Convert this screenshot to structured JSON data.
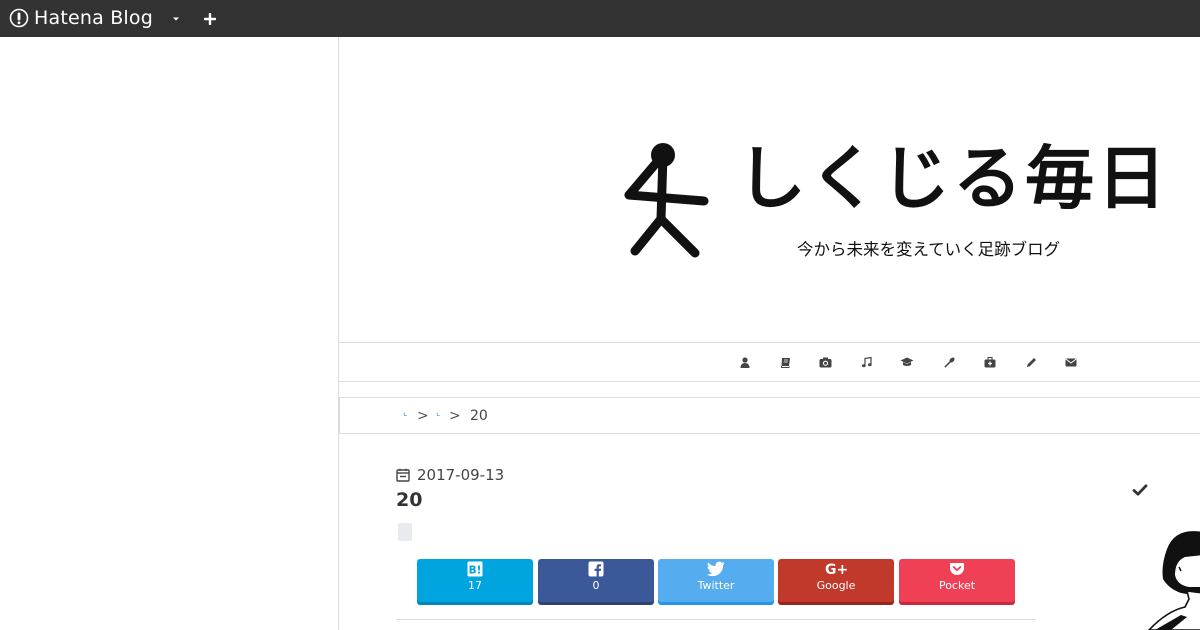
{
  "topbar": {
    "brand": "Hatena Blog",
    "dropdown_icon": "caret-down-icon",
    "add_icon": "plus-icon",
    "bg_color": "#333333"
  },
  "header": {
    "title": "しくじる毎日",
    "subtitle": "今から未来を変えていく足跡ブログ"
  },
  "nav": {
    "icons": [
      "user-icon",
      "book-icon",
      "camera-icon",
      "music-icon",
      "graduation-cap-icon",
      "wrench-icon",
      "medkit-icon",
      "pencil-icon",
      "envelope-icon"
    ]
  },
  "breadcrumb": {
    "sep": ">",
    "current": "20"
  },
  "article": {
    "date": "2017-09-13",
    "title": "20"
  },
  "share": {
    "hatena": {
      "count": "17",
      "color": "#00a4de"
    },
    "facebook": {
      "count": "0",
      "color": "#3b5998"
    },
    "twitter": {
      "label": "Twitter",
      "color": "#55acee"
    },
    "google": {
      "label": "Google",
      "color": "#c0392b"
    },
    "pocket": {
      "label": "Pocket",
      "color": "#ef4056"
    }
  }
}
